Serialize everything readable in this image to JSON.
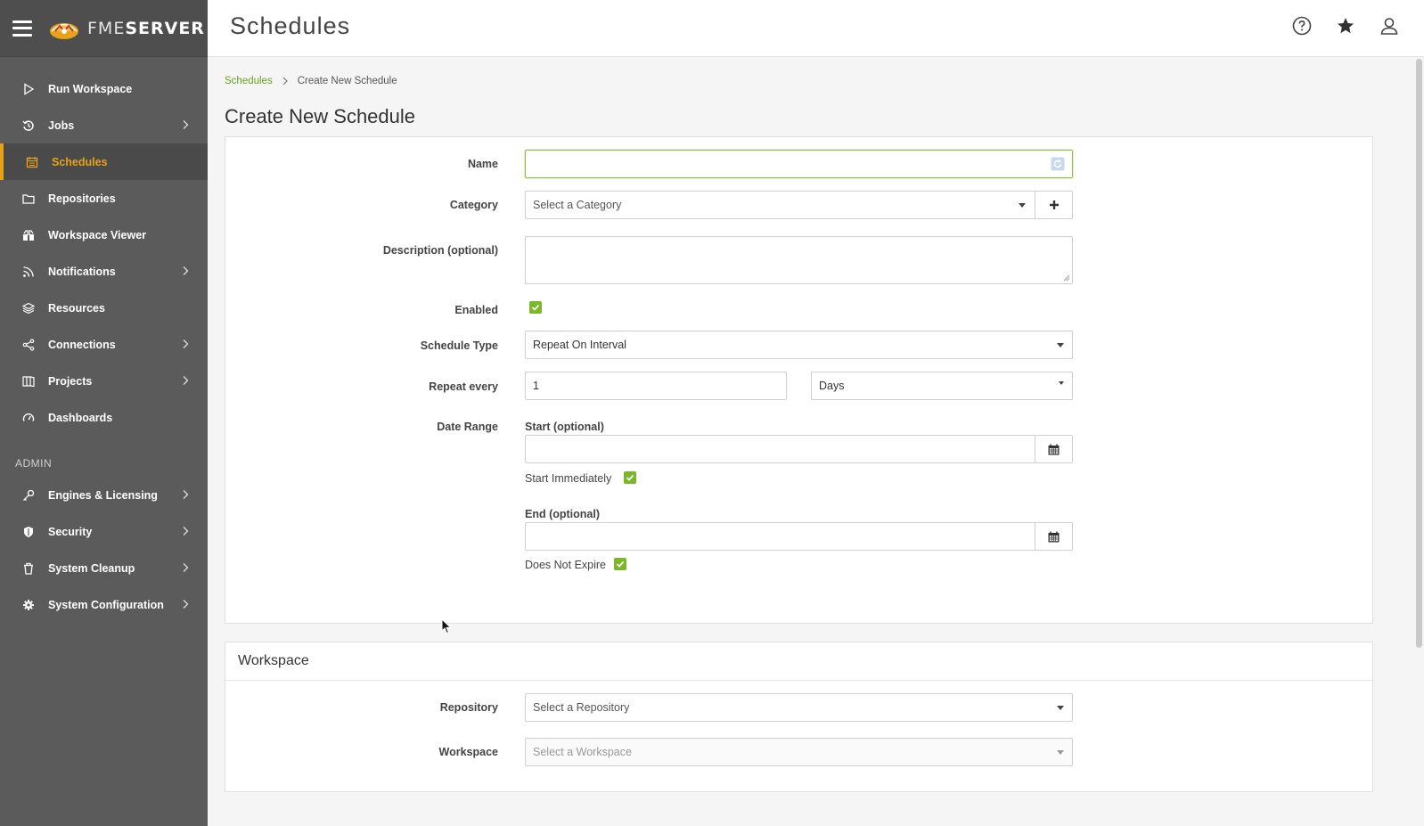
{
  "app": {
    "logo_fme": "FME",
    "logo_server": "SERVER"
  },
  "header": {
    "title": "Schedules"
  },
  "sidebar": {
    "items": [
      {
        "label": "Run Workspace",
        "icon": "play-icon",
        "chevron": false
      },
      {
        "label": "Jobs",
        "icon": "history-icon",
        "chevron": true
      },
      {
        "label": "Schedules",
        "icon": "calendar-icon",
        "chevron": false,
        "active": true
      },
      {
        "label": "Repositories",
        "icon": "folder-icon",
        "chevron": false
      },
      {
        "label": "Workspace Viewer",
        "icon": "binoculars-icon",
        "chevron": false
      },
      {
        "label": "Notifications",
        "icon": "rss-icon",
        "chevron": true
      },
      {
        "label": "Resources",
        "icon": "layers-icon",
        "chevron": false
      },
      {
        "label": "Connections",
        "icon": "share-icon",
        "chevron": true
      },
      {
        "label": "Projects",
        "icon": "book-icon",
        "chevron": true
      },
      {
        "label": "Dashboards",
        "icon": "gauge-icon",
        "chevron": false
      }
    ],
    "admin_label": "ADMIN",
    "admin_items": [
      {
        "label": "Engines & Licensing",
        "icon": "key-icon",
        "chevron": true
      },
      {
        "label": "Security",
        "icon": "shield-icon",
        "chevron": true
      },
      {
        "label": "System Cleanup",
        "icon": "trash-icon",
        "chevron": true
      },
      {
        "label": "System Configuration",
        "icon": "gear-icon",
        "chevron": true
      }
    ]
  },
  "breadcrumb": {
    "link": "Schedules",
    "current": "Create New Schedule"
  },
  "form": {
    "title": "Create New Schedule",
    "name_label": "Name",
    "name_value": "",
    "category_label": "Category",
    "category_placeholder": "Select a Category",
    "description_label": "Description (optional)",
    "enabled_label": "Enabled",
    "enabled": true,
    "schedule_type_label": "Schedule Type",
    "schedule_type_value": "Repeat On Interval",
    "repeat_label": "Repeat every",
    "repeat_value": "1",
    "repeat_unit": "Days",
    "date_range_label": "Date Range",
    "start_label": "Start (optional)",
    "start_immediately_label": "Start Immediately",
    "start_immediately": true,
    "end_label": "End (optional)",
    "does_not_expire_label": "Does Not Expire",
    "does_not_expire": true
  },
  "workspace_section": {
    "title": "Workspace",
    "repository_label": "Repository",
    "repository_placeholder": "Select a Repository",
    "workspace_label": "Workspace",
    "workspace_placeholder": "Select a Workspace"
  },
  "colors": {
    "accent_green": "#7ab829",
    "active_orange": "#e8a21a",
    "sidebar_bg": "#5b5b5b"
  }
}
